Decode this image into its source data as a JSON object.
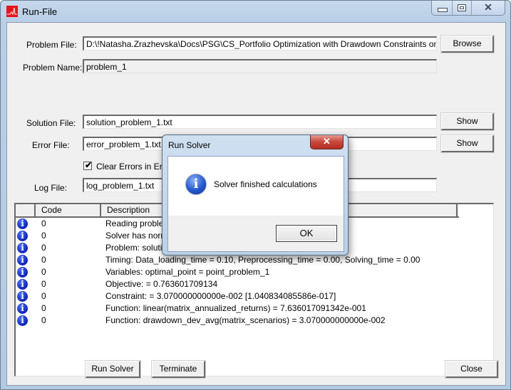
{
  "window": {
    "title": "Run-File",
    "icon": "psg-app-icon",
    "controls": {
      "minimize": "minimize-icon",
      "maximize": "maximize-icon",
      "close_glyph": "✕"
    }
  },
  "form": {
    "problem_file": {
      "label": "Problem File:",
      "value": "D:\\!Natasha.Zrazhevska\\Docs\\PSG\\CS_Portfolio Optimization with Drawdown Constraints on a Single P"
    },
    "browse_button": "Browse",
    "problem_name": {
      "label": "Problem Name:",
      "value": "problem_1"
    },
    "solution_file": {
      "label": "Solution File:",
      "value": "solution_problem_1.txt"
    },
    "show_solution_button": "Show",
    "error_file": {
      "label": "Error File:",
      "value": "error_problem_1.txt"
    },
    "show_error_button": "Show",
    "clear_errors": {
      "label": "Clear Errors in Error File",
      "checked": true,
      "check_glyph": "✔"
    },
    "log_file": {
      "label": "Log File:",
      "value": "log_problem_1.txt"
    }
  },
  "log_table": {
    "columns": [
      "",
      "Code",
      "Description",
      ""
    ],
    "rows": [
      {
        "icon": "info-icon",
        "code": "0",
        "description": "Reading problem"
      },
      {
        "icon": "info-icon",
        "code": "0",
        "description": "Solver has normally finished"
      },
      {
        "icon": "info-icon",
        "code": "0",
        "description": "Problem: solution"
      },
      {
        "icon": "info-icon",
        "code": "0",
        "description": "Timing: Data_loading_time = 0.10, Preprocessing_time = 0.00, Solving_time = 0.00"
      },
      {
        "icon": "info-icon",
        "code": "0",
        "description": "Variables: optimal_point = point_problem_1"
      },
      {
        "icon": "info-icon",
        "code": "0",
        "description": "Objective:   = 0.763601709134"
      },
      {
        "icon": "info-icon",
        "code": "0",
        "description": "Constraint:  = 3.070000000000e-002 [1.040834085586e-017]"
      },
      {
        "icon": "info-icon",
        "code": "0",
        "description": "Function: linear(matrix_annualized_returns) = 7.636017091342e-001"
      },
      {
        "icon": "info-icon",
        "code": "0",
        "description": "Function: drawdown_dev_avg(matrix_scenarios) = 3.070000000000e-002"
      }
    ],
    "info_glyph": "i"
  },
  "footer": {
    "run_solver_button": "Run Solver",
    "terminate_button": "Terminate",
    "close_button": "Close"
  },
  "dialog": {
    "title": "Run Solver",
    "close_glyph": "✕",
    "message": "Solver finished calculations",
    "info_glyph": "i",
    "ok_button": "OK"
  }
}
